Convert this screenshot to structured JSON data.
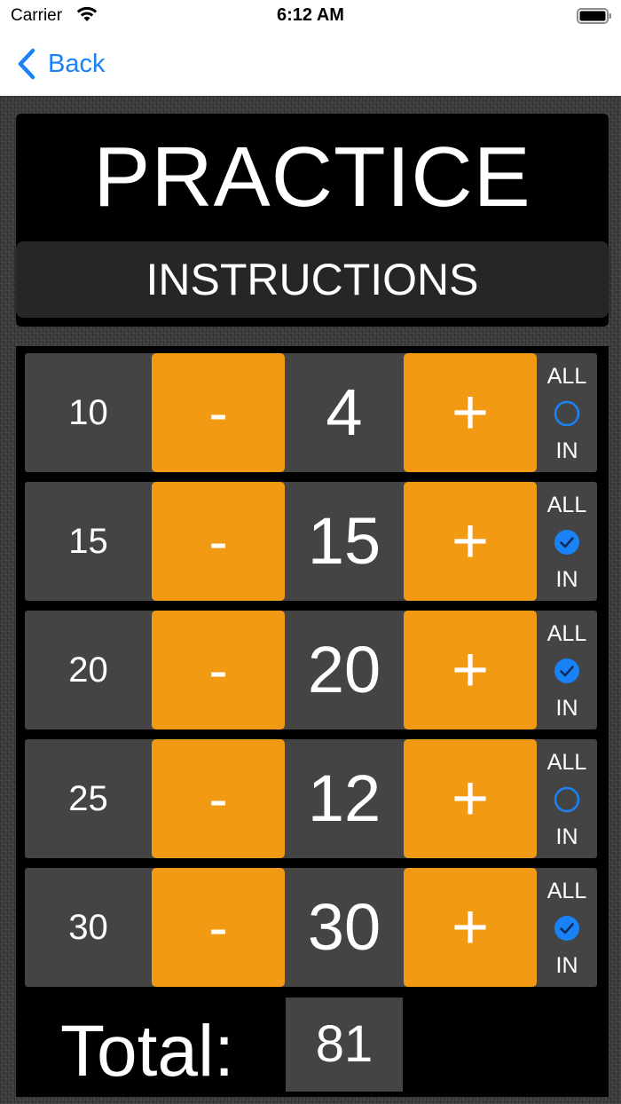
{
  "status_bar": {
    "carrier": "Carrier",
    "time": "6:12 AM"
  },
  "nav": {
    "back_label": "Back",
    "accent": "#1a82f7"
  },
  "header": {
    "title": "PRACTICE",
    "instructions_label": "INSTRUCTIONS"
  },
  "rows": [
    {
      "label": "10",
      "minus": "-",
      "count": "4",
      "plus": "+",
      "all_label": "ALL",
      "in_label": "IN",
      "all_in_checked": false
    },
    {
      "label": "15",
      "minus": "-",
      "count": "15",
      "plus": "+",
      "all_label": "ALL",
      "in_label": "IN",
      "all_in_checked": true
    },
    {
      "label": "20",
      "minus": "-",
      "count": "20",
      "plus": "+",
      "all_label": "ALL",
      "in_label": "IN",
      "all_in_checked": true
    },
    {
      "label": "25",
      "minus": "-",
      "count": "12",
      "plus": "+",
      "all_label": "ALL",
      "in_label": "IN",
      "all_in_checked": false
    },
    {
      "label": "30",
      "minus": "-",
      "count": "30",
      "plus": "+",
      "all_label": "ALL",
      "in_label": "IN",
      "all_in_checked": true
    }
  ],
  "total": {
    "label": "Total:",
    "value": "81"
  },
  "colors": {
    "button": "#f29a13",
    "cell": "#444444",
    "radio": "#1a82f7"
  },
  "icons": {
    "back": "chevron-left-icon",
    "radio_checked": "checkmark-circle-icon",
    "radio_unchecked": "empty-circle-icon"
  }
}
